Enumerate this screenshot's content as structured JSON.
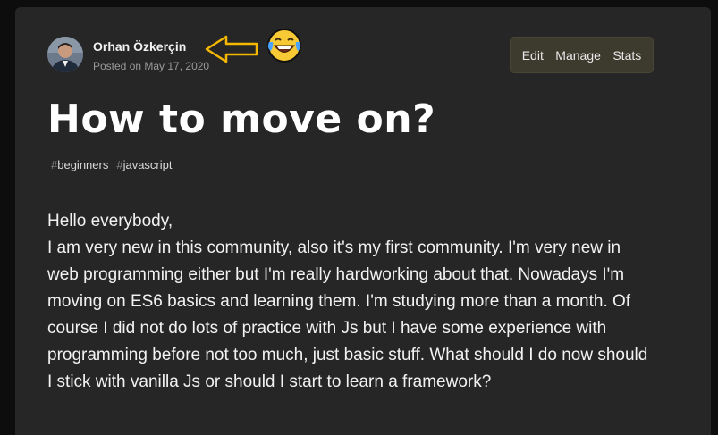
{
  "author": {
    "name": "Orhan Özkerçin",
    "posted": "Posted on May 17, 2020"
  },
  "annotation": {
    "icon": "left-arrow-icon",
    "emoji": "😂",
    "emoji_name": "laughing-tears-icon",
    "arrow_color": "#f5b800"
  },
  "actions": {
    "edit": "Edit",
    "manage": "Manage",
    "stats": "Stats"
  },
  "post": {
    "title": "How to move on?",
    "tags": [
      "beginners",
      "javascript"
    ],
    "tag_hash": "#",
    "body": [
      "Hello everybody,",
      "I am very new in this community, also it's my first community. I'm very new in web programming either but I'm really hardworking about that. Nowadays I'm moving on ES6 basics and learning them. I'm studying more than a month. Of course I did not do lots of practice with Js but I have some experience with programming before not too much, just basic stuff. What should I do now should I stick with vanilla Js or should I start to learn a framework?"
    ]
  },
  "colors": {
    "page_bg": "#0d0d0d",
    "card_bg": "#262626",
    "actions_bg": "#3d3a2e"
  }
}
